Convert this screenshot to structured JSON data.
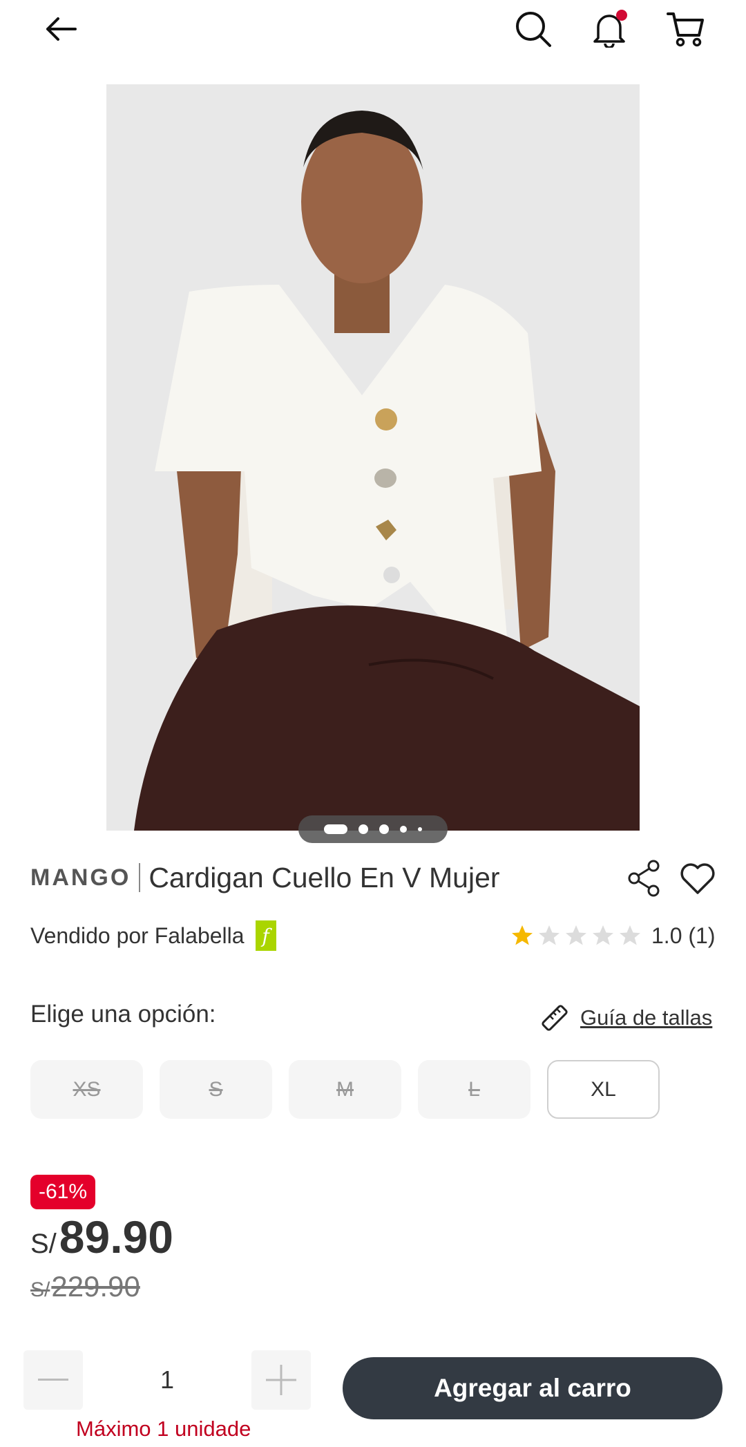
{
  "header": {
    "back_icon": "arrow-left-icon",
    "search_icon": "search-icon",
    "notifications_icon": "bell-icon",
    "cart_icon": "cart-icon",
    "notification_dot_color": "#d10a34"
  },
  "gallery": {
    "image_count": 5,
    "active_index": 0
  },
  "product": {
    "brand": "MANGO",
    "name": "Cardigan Cuello En V Mujer",
    "seller_text": "Vendido por Falabella",
    "seller_badge": "f",
    "rating_value": 1,
    "rating_max": 5,
    "rating_text": "1.0 (1)"
  },
  "options": {
    "label": "Elige una opción:",
    "size_guide": "Guía de tallas",
    "sizes": [
      {
        "label": "XS",
        "available": false
      },
      {
        "label": "S",
        "available": false
      },
      {
        "label": "M",
        "available": false
      },
      {
        "label": "L",
        "available": false
      },
      {
        "label": "XL",
        "available": true
      }
    ]
  },
  "price": {
    "discount": "-61%",
    "currency": "S/",
    "current": "89.90",
    "original": "229.90"
  },
  "cart": {
    "quantity": "1",
    "add_label": "Agregar al carro",
    "max_text": "Máximo 1 unidade"
  },
  "colors": {
    "accent_red": "#e4002b",
    "button_dark": "#333a43",
    "falabella_green": "#aad500",
    "star_gold": "#f5b800"
  }
}
